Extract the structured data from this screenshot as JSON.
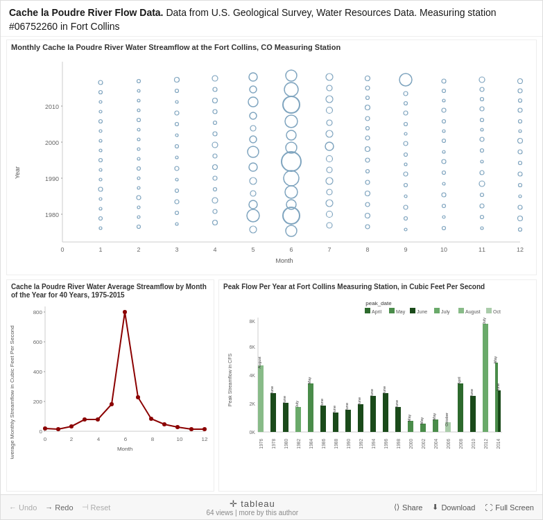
{
  "header": {
    "title_bold": "Cache la Poudre River Flow Data.",
    "title_rest": " Data from U.S. Geological Survey, Water Resources Data. Measuring station #06752260 in Fort Collins"
  },
  "top_chart": {
    "title": "Monthly Cache la Poudre River Water Streamflow at the Fort Collins, CO Measuring Station",
    "x_label": "Month",
    "y_label": "Year",
    "x_ticks": [
      "0",
      "1",
      "2",
      "3",
      "4",
      "5",
      "6",
      "7",
      "8",
      "9",
      "10",
      "11",
      "12"
    ],
    "y_ticks": [
      "1980",
      "1990",
      "2000",
      "2010"
    ]
  },
  "bottom_left_chart": {
    "title": "Cache la Poudre River Water Average Streamflow by Month of the Year for 40 Years, 1975-2015",
    "x_label": "Month",
    "y_label": "Average Monthly Streamflow in Cubic Feet Per Second",
    "x_ticks": [
      "0",
      "2",
      "4",
      "6",
      "8",
      "10",
      "12"
    ],
    "y_ticks": [
      "0",
      "200",
      "400",
      "600",
      "800"
    ]
  },
  "bottom_right_chart": {
    "title": "Peak Flow Per Year at Fort Collins Measuring Station, in Cubic Feet Per Second",
    "x_label": "",
    "y_label": "Peak Streamflow in CFS",
    "legend_title": "peak_date",
    "y_ticks": [
      "0K",
      "2K",
      "4K",
      "6K",
      "8K"
    ],
    "x_ticks": [
      "1976",
      "1978",
      "1980",
      "1982",
      "1984",
      "1986",
      "1988",
      "1990",
      "1992",
      "1994",
      "1996",
      "1998",
      "2000",
      "2002",
      "2004",
      "2006",
      "2008",
      "2010",
      "2012",
      "2014"
    ]
  },
  "footer": {
    "undo_label": "Undo",
    "redo_label": "Redo",
    "reset_label": "Reset",
    "logo_text": "✛ tableau",
    "views_text": "64 views | more by this author",
    "share_label": "Share",
    "download_label": "Download",
    "fullscreen_label": "Full Screen"
  }
}
